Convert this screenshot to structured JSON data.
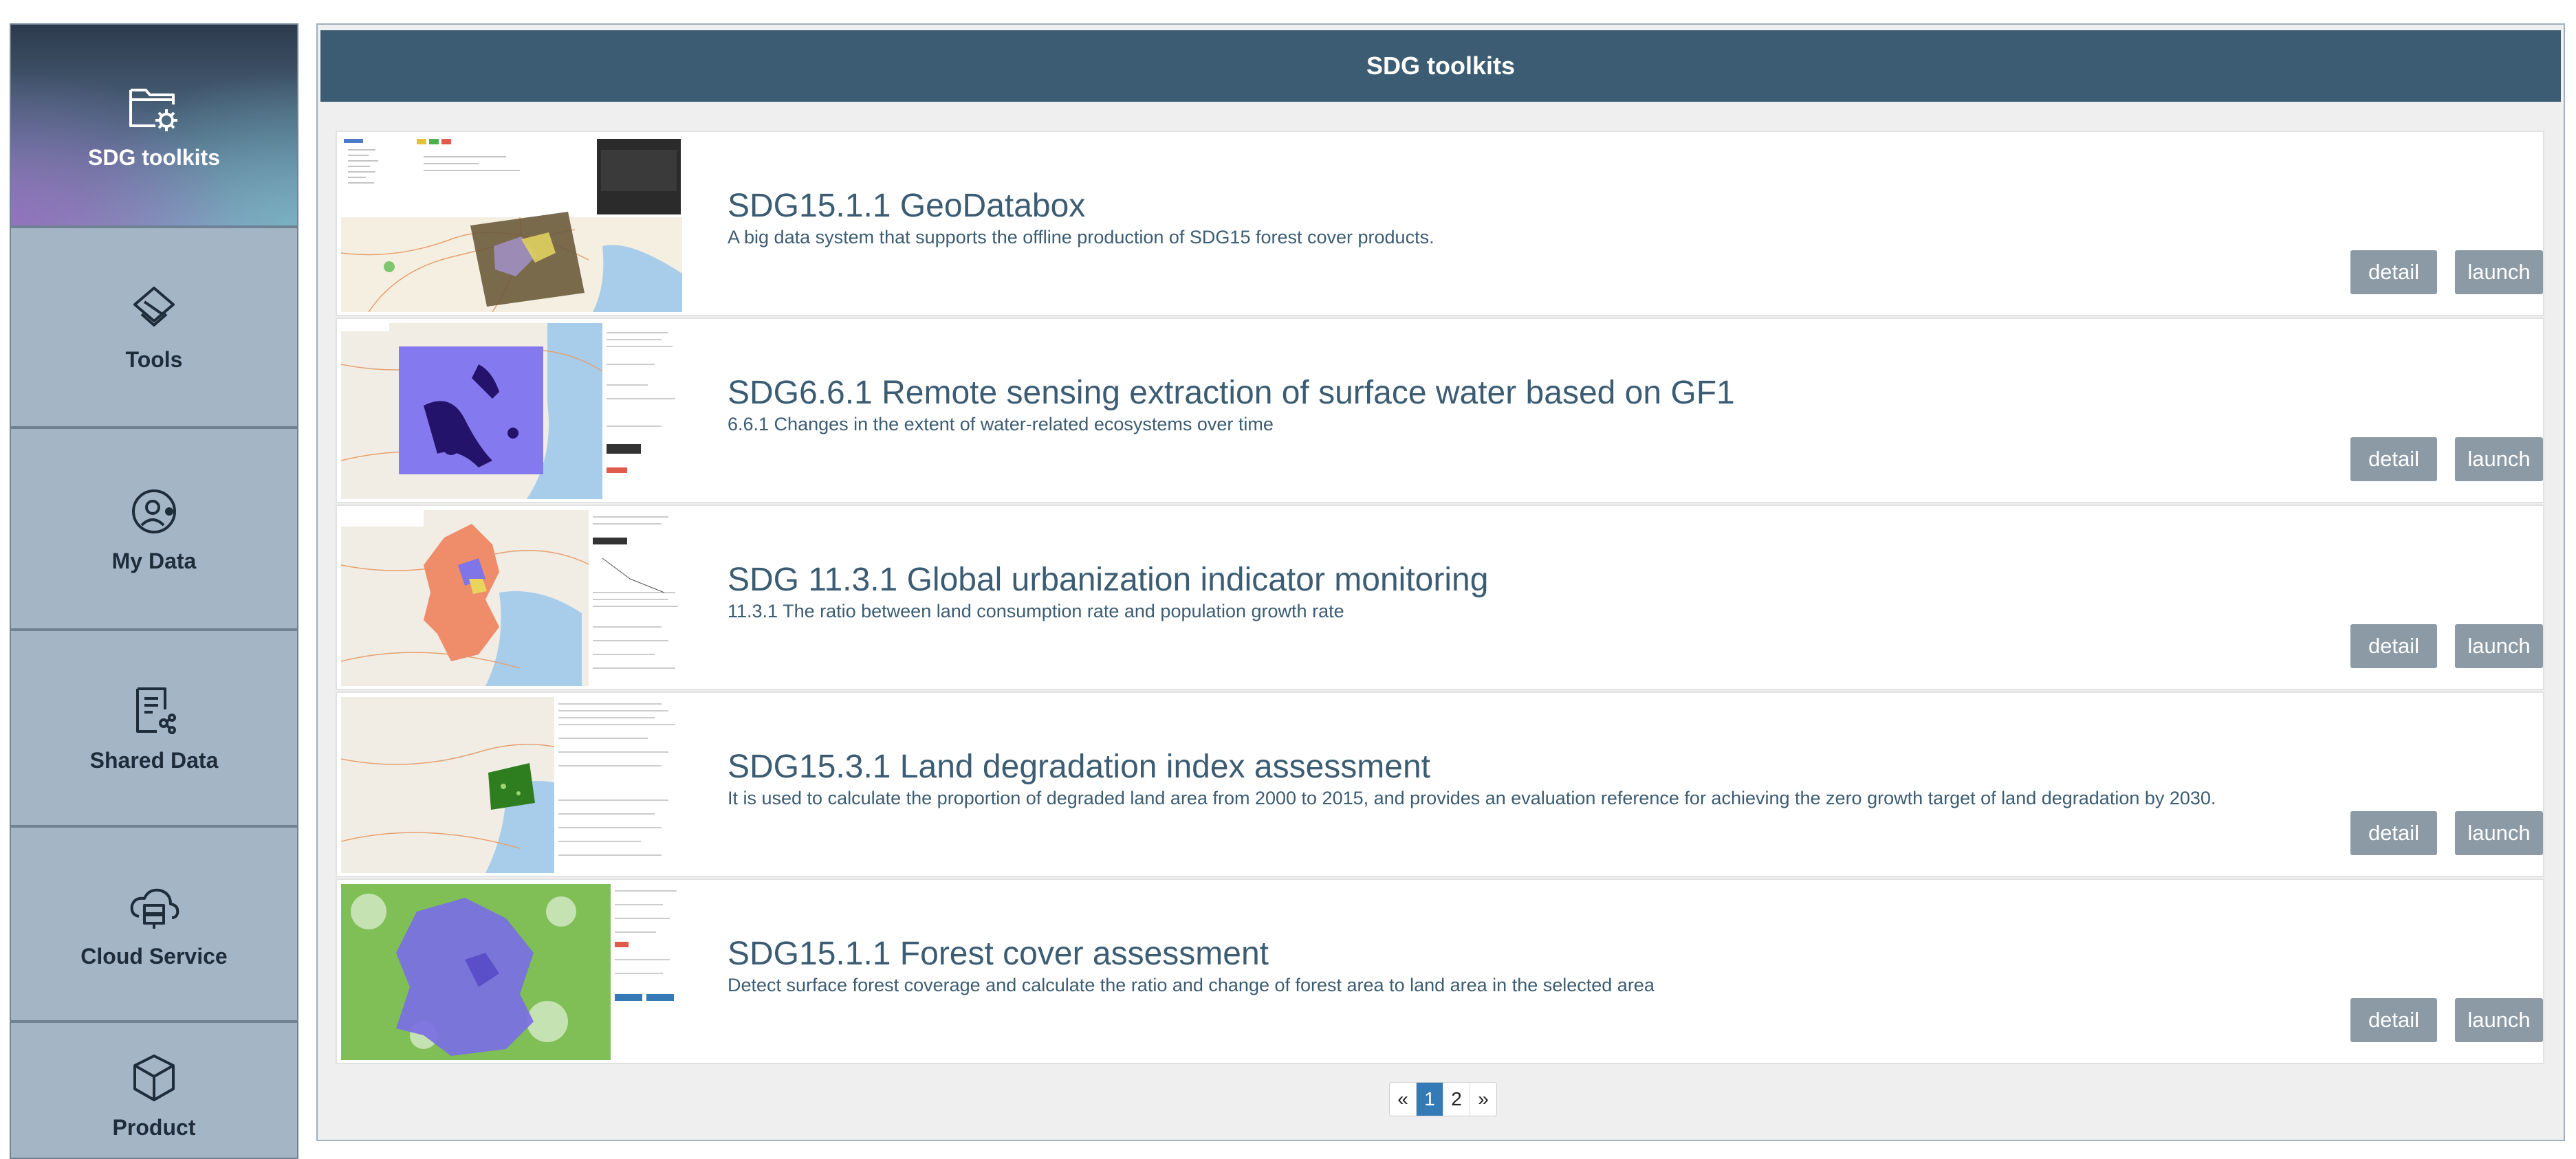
{
  "sidebar": {
    "items": [
      {
        "label": "SDG toolkits",
        "icon": "folder-gear-icon",
        "active": true
      },
      {
        "label": "Tools",
        "icon": "layers-diamond-icon"
      },
      {
        "label": "My Data",
        "icon": "user-circle-icon"
      },
      {
        "label": "Shared Data",
        "icon": "shared-document-icon"
      },
      {
        "label": "Cloud Service",
        "icon": "cloud-server-icon"
      },
      {
        "label": "Product",
        "icon": "cube-icon"
      }
    ]
  },
  "header": {
    "title": "SDG toolkits"
  },
  "toolkits": [
    {
      "title": "SDG15.1.1 GeoDatabox",
      "description": "A big data system that supports the offline production of SDG15 forest cover products.",
      "detail_label": "detail",
      "launch_label": "launch"
    },
    {
      "title": "SDG6.6.1 Remote sensing extraction of surface water based on GF1",
      "description": "6.6.1 Changes in the extent of water-related ecosystems over time",
      "detail_label": "detail",
      "launch_label": "launch"
    },
    {
      "title": "SDG 11.3.1 Global urbanization indicator monitoring",
      "description": "11.3.1 The ratio between land consumption rate and population growth rate",
      "detail_label": "detail",
      "launch_label": "launch"
    },
    {
      "title": "SDG15.3.1 Land degradation index assessment",
      "description": "It is used to calculate the proportion of degraded land area from 2000 to 2015, and provides an evaluation reference for achieving the zero growth target of land degradation by 2030.",
      "detail_label": "detail",
      "launch_label": "launch"
    },
    {
      "title": "SDG15.1.1 Forest cover assessment",
      "description": "Detect surface forest coverage and calculate the ratio and change of forest area to land area in the selected area",
      "detail_label": "detail",
      "launch_label": "launch"
    }
  ],
  "pagination": {
    "prev": "«",
    "pages": [
      "1",
      "2"
    ],
    "current": "1",
    "next": "»"
  },
  "colors": {
    "header": "#3b5c72",
    "button": "#8b9aa5",
    "sidebar": "#a4b5c5",
    "page_active": "#337ab7"
  }
}
